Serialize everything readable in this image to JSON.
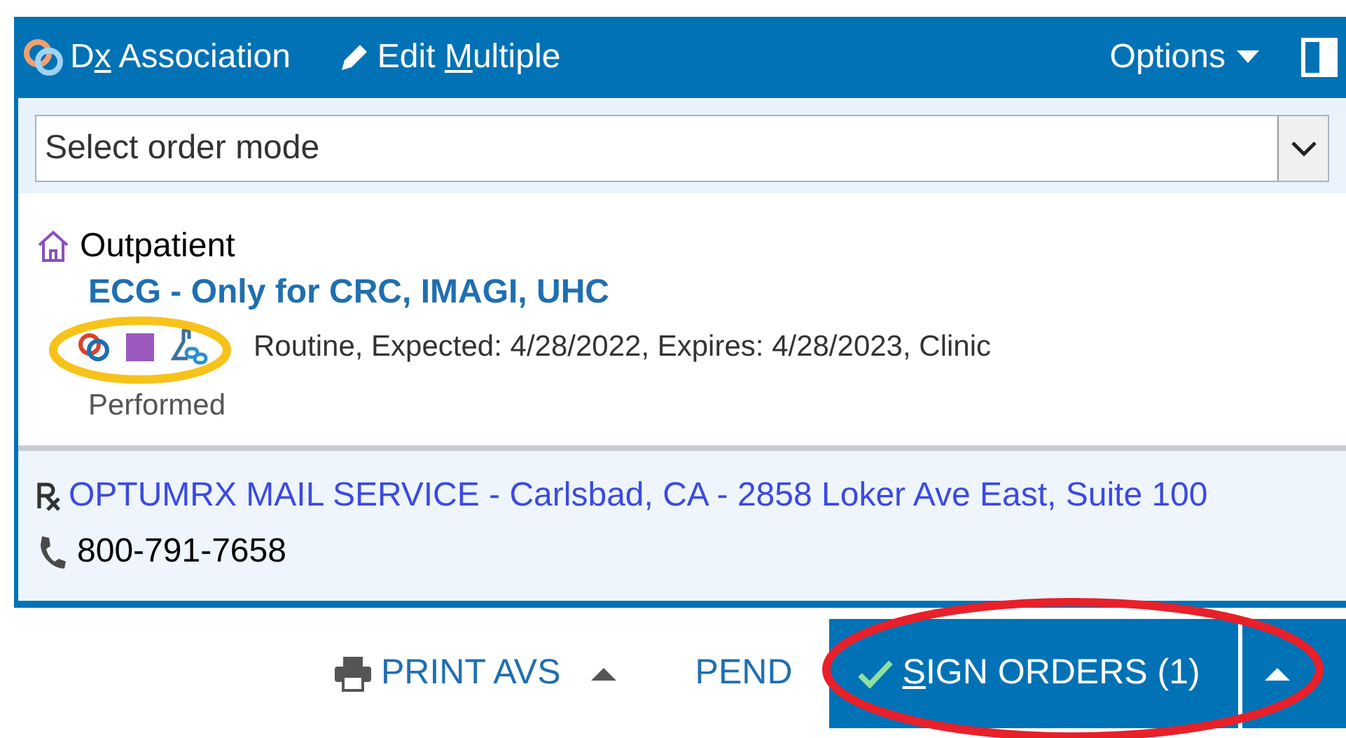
{
  "toolbar": {
    "items": [
      {
        "kind": "dx",
        "before": "D",
        "mnemonic": "x",
        "after": " Association"
      },
      {
        "kind": "edit",
        "before": "Edit ",
        "mnemonic": "M",
        "after": "ultiple"
      }
    ],
    "options": "Options"
  },
  "order_mode": {
    "placeholder": "Select order mode"
  },
  "encounter": {
    "label": "Outpatient"
  },
  "orders": [
    {
      "title": "ECG - Only for CRC, IMAGI, UHC",
      "details": "Routine, Expected: 4/28/2022, Expires: 4/28/2023, Clinic",
      "status": "Performed"
    }
  ],
  "pharmacy": {
    "name": "OPTUMRX MAIL SERVICE - Carlsbad, CA - 2858 Loker Ave East, Suite 100",
    "phone": "800-791-7658"
  },
  "actions": [
    {
      "kind": "print",
      "label": "PRINT AVS"
    },
    {
      "kind": "pend",
      "label": "PEND"
    },
    {
      "kind": "sign",
      "mnemonic": "S",
      "after": "IGN ORDERS (1)"
    }
  ],
  "annotations": [
    {
      "kind": "icons",
      "color": "#f7c31a"
    },
    {
      "kind": "sign",
      "color": "#e8202a"
    }
  ]
}
